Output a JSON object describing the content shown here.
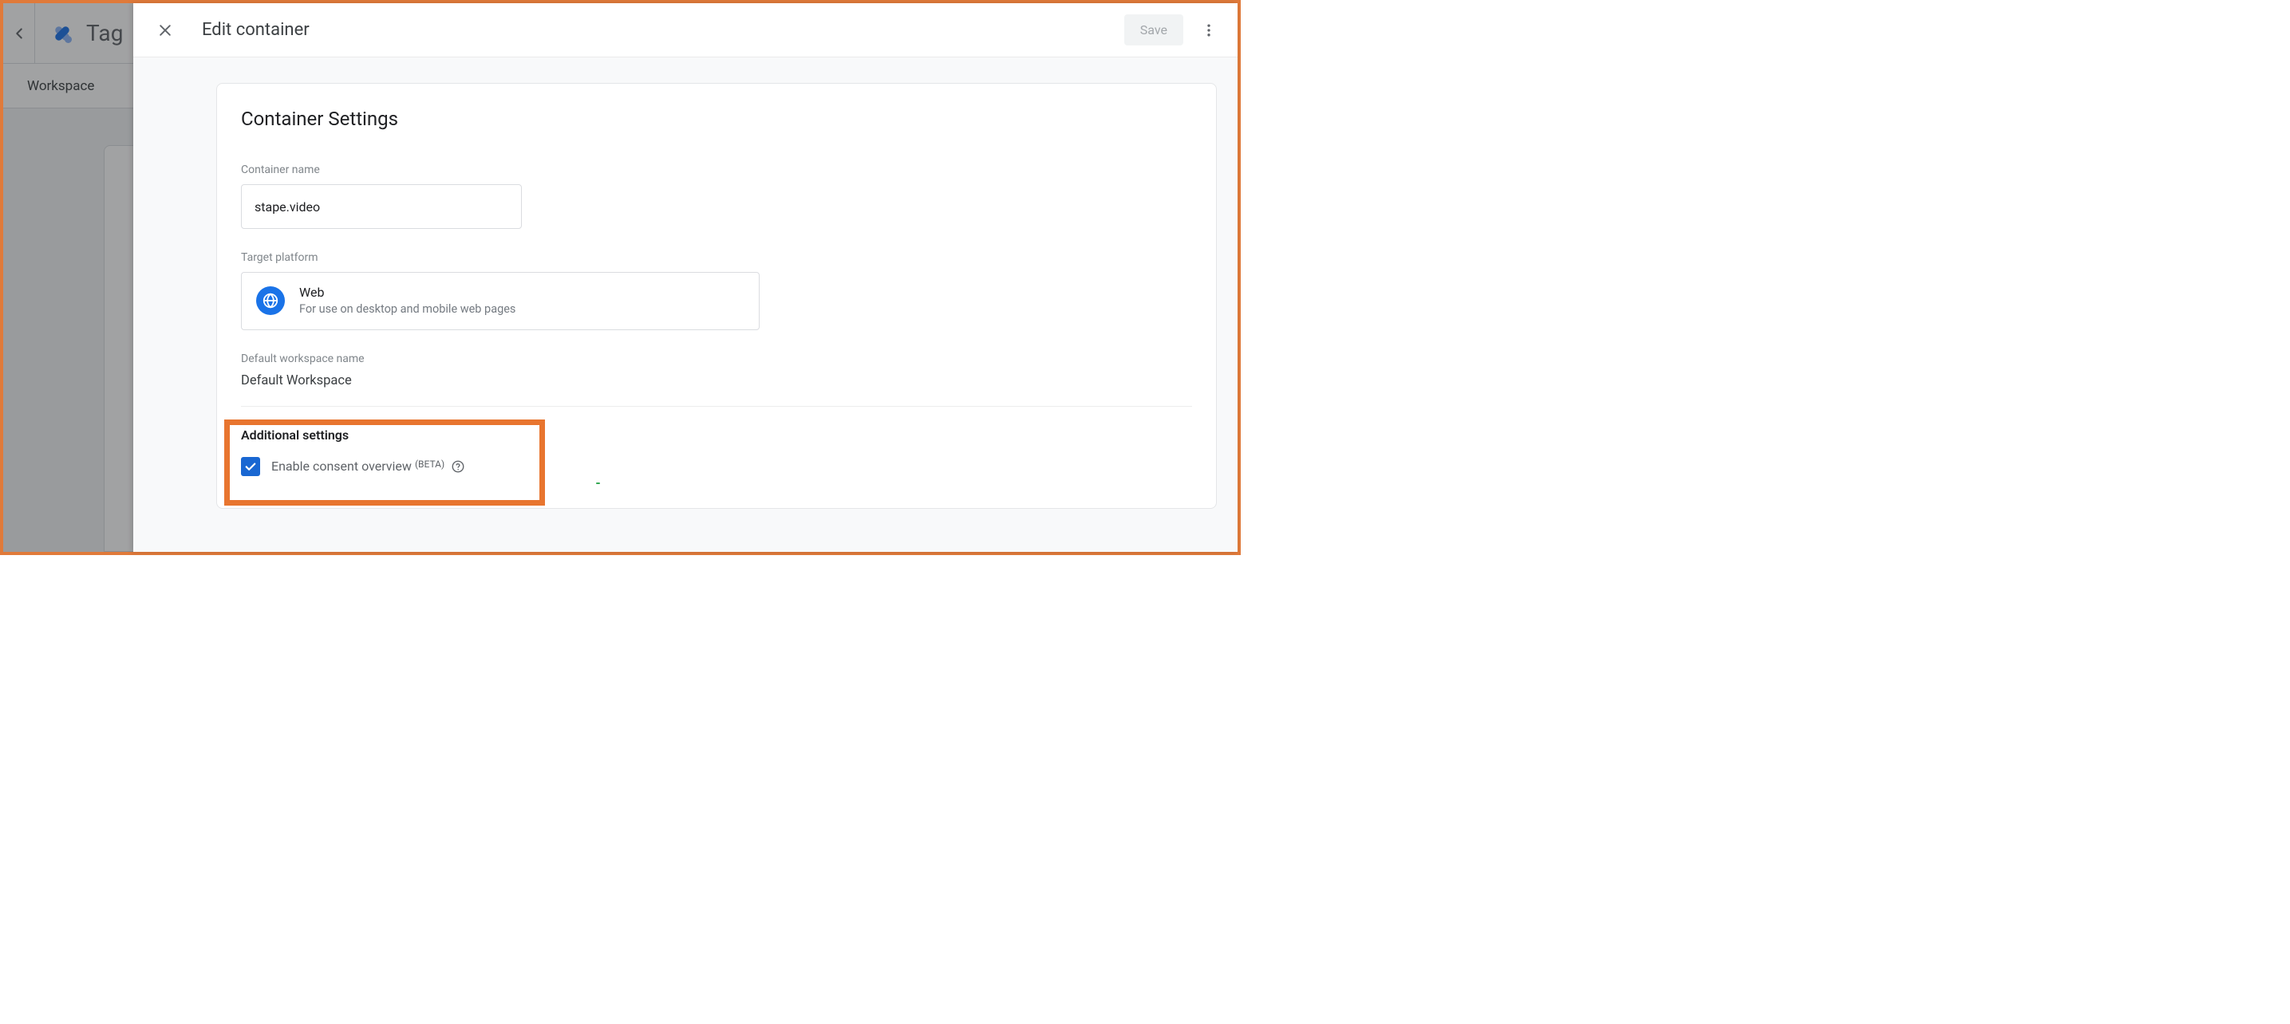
{
  "background": {
    "app_title": "Tag",
    "tab_workspace": "Workspace"
  },
  "modal": {
    "title": "Edit container",
    "save_label": "Save"
  },
  "settings": {
    "heading": "Container Settings",
    "name_label": "Container name",
    "name_value": "stape.video",
    "platform_label": "Target platform",
    "platform_title": "Web",
    "platform_subtitle": "For use on desktop and mobile web pages",
    "workspace_label": "Default workspace name",
    "workspace_value": "Default Workspace",
    "additional_heading": "Additional settings",
    "consent_label": "Enable consent overview",
    "consent_beta": "(BETA)",
    "consent_checked": true
  }
}
